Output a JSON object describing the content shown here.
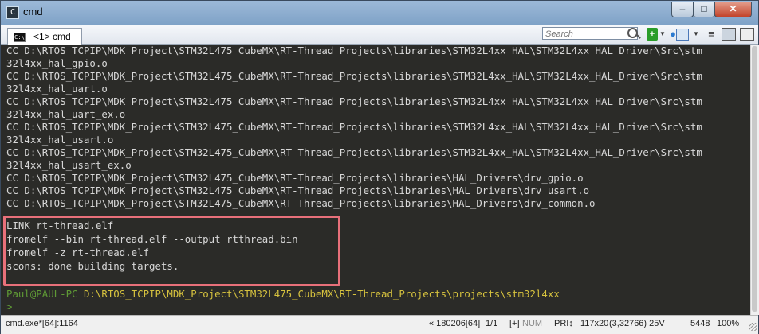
{
  "window": {
    "title": "cmd",
    "app_icon": "console-app-icon",
    "min_glyph": "–",
    "max_glyph": "□",
    "close_glyph": "✕"
  },
  "toolbar": {
    "tab_label": "<1> cmd",
    "tab_icon_glyph": "C:\\",
    "search_placeholder": "Search",
    "new_console_glyph": "+",
    "dropdown_glyph": "▼",
    "restart_glyph": "●",
    "menu_glyph": "≡"
  },
  "terminal": {
    "lines": [
      "CC D:\\RTOS_TCPIP\\MDK_Project\\STM32L475_CubeMX\\RT-Thread_Projects\\libraries\\STM32L4xx_HAL\\STM32L4xx_HAL_Driver\\Src\\stm",
      "32l4xx_hal_gpio.o",
      "CC D:\\RTOS_TCPIP\\MDK_Project\\STM32L475_CubeMX\\RT-Thread_Projects\\libraries\\STM32L4xx_HAL\\STM32L4xx_HAL_Driver\\Src\\stm",
      "32l4xx_hal_uart.o",
      "CC D:\\RTOS_TCPIP\\MDK_Project\\STM32L475_CubeMX\\RT-Thread_Projects\\libraries\\STM32L4xx_HAL\\STM32L4xx_HAL_Driver\\Src\\stm",
      "32l4xx_hal_uart_ex.o",
      "CC D:\\RTOS_TCPIP\\MDK_Project\\STM32L475_CubeMX\\RT-Thread_Projects\\libraries\\STM32L4xx_HAL\\STM32L4xx_HAL_Driver\\Src\\stm",
      "32l4xx_hal_usart.o",
      "CC D:\\RTOS_TCPIP\\MDK_Project\\STM32L475_CubeMX\\RT-Thread_Projects\\libraries\\STM32L4xx_HAL\\STM32L4xx_HAL_Driver\\Src\\stm",
      "32l4xx_hal_usart_ex.o",
      "CC D:\\RTOS_TCPIP\\MDK_Project\\STM32L475_CubeMX\\RT-Thread_Projects\\libraries\\HAL_Drivers\\drv_gpio.o",
      "CC D:\\RTOS_TCPIP\\MDK_Project\\STM32L475_CubeMX\\RT-Thread_Projects\\libraries\\HAL_Drivers\\drv_usart.o",
      "CC D:\\RTOS_TCPIP\\MDK_Project\\STM32L475_CubeMX\\RT-Thread_Projects\\libraries\\HAL_Drivers\\drv_common.o",
      "LINK rt-thread.elf",
      "fromelf --bin rt-thread.elf --output rtthread.bin",
      "fromelf -z rt-thread.elf",
      "scons: done building targets.",
      ""
    ],
    "prompt_user": "Paul@PAUL-PC",
    "prompt_path": "D:\\RTOS_TCPIP\\MDK_Project\\STM32L475_CubeMX\\RT-Thread_Projects\\projects\\stm32l4xx",
    "prompt_symbol": ">",
    "highlight_color": "#e8707a"
  },
  "statusbar": {
    "process": "cmd.exe*[64]:1164",
    "char_code": "« 180206[64]",
    "position": "1/1",
    "bracket": "[+]",
    "num": "NUM",
    "pri": "PRI↕",
    "size": "117x20",
    "pid": "(3,32766) 25V",
    "ms": "5448",
    "zoom": "100%"
  }
}
